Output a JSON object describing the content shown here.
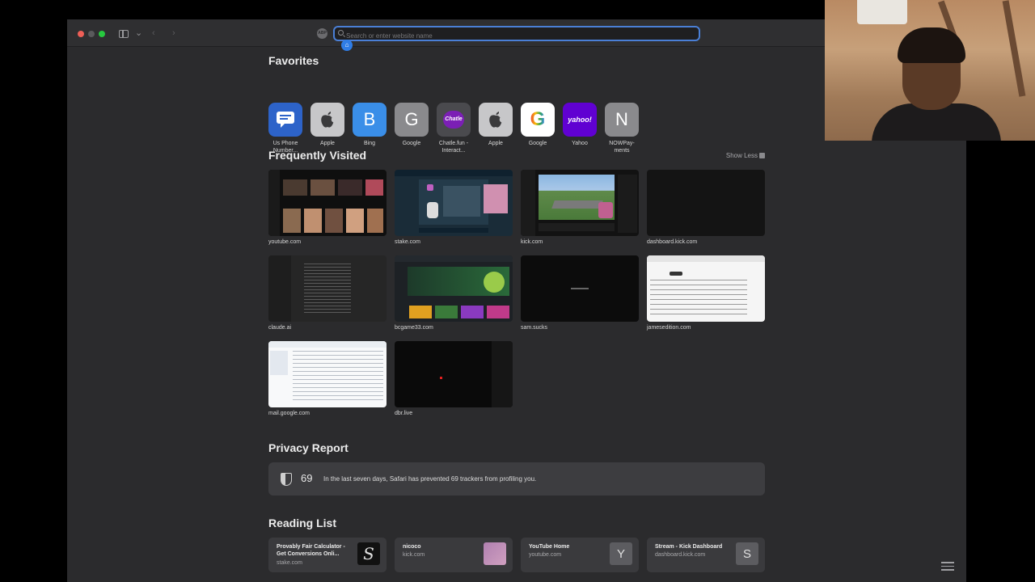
{
  "browser": {
    "address_placeholder": "Search or enter website name",
    "home_badge": "⌂"
  },
  "favorites": {
    "heading": "Favorites",
    "items": [
      {
        "label": "Us Phone Number...",
        "glyph": "",
        "bg": "#2d63c9"
      },
      {
        "label": "Apple",
        "glyph": "",
        "bg": "#c7c7c9"
      },
      {
        "label": "Bing",
        "glyph": "B",
        "bg": "#3a8ee8"
      },
      {
        "label": "Google",
        "glyph": "G",
        "bg": "#8a8a8d"
      },
      {
        "label": "Chatle.fun - Interact...",
        "glyph": "Chatle",
        "bg": "#4a4a4e"
      },
      {
        "label": "Apple",
        "glyph": "",
        "bg": "#c7c7c9"
      },
      {
        "label": "Google",
        "glyph": "G",
        "bg": "#ffffff"
      },
      {
        "label": "Yahoo",
        "glyph": "yahoo!",
        "bg": "#6001d2"
      },
      {
        "label": "NOWPay-ments",
        "glyph": "N",
        "bg": "#8a8a8d"
      }
    ]
  },
  "frequently_visited": {
    "heading": "Frequently Visited",
    "show_less": "Show Less",
    "items": [
      {
        "url": "youtube.com"
      },
      {
        "url": "stake.com"
      },
      {
        "url": "kick.com"
      },
      {
        "url": "dashboard.kick.com"
      },
      {
        "url": "claude.ai"
      },
      {
        "url": "bcgame33.com"
      },
      {
        "url": "sam.sucks"
      },
      {
        "url": "jamesedition.com"
      },
      {
        "url": "mail.google.com"
      },
      {
        "url": "dbr.live"
      }
    ]
  },
  "privacy_report": {
    "heading": "Privacy Report",
    "count": "69",
    "message": "In the last seven days, Safari has prevented 69 trackers from profiling you."
  },
  "reading_list": {
    "heading": "Reading List",
    "items": [
      {
        "title": "Provably Fair Calculator - Get Conversions Onli...",
        "domain": "stake.com",
        "glyph": "S"
      },
      {
        "title": "nicoco",
        "domain": "kick.com",
        "glyph": ""
      },
      {
        "title": "YouTube Home",
        "domain": "youtube.com",
        "glyph": "Y"
      },
      {
        "title": "Stream - Kick Dashboard",
        "domain": "dashboard.kick.com",
        "glyph": "S"
      }
    ]
  },
  "colors": {
    "window_bg": "#2b2b2d",
    "accent": "#4a7fd6"
  }
}
